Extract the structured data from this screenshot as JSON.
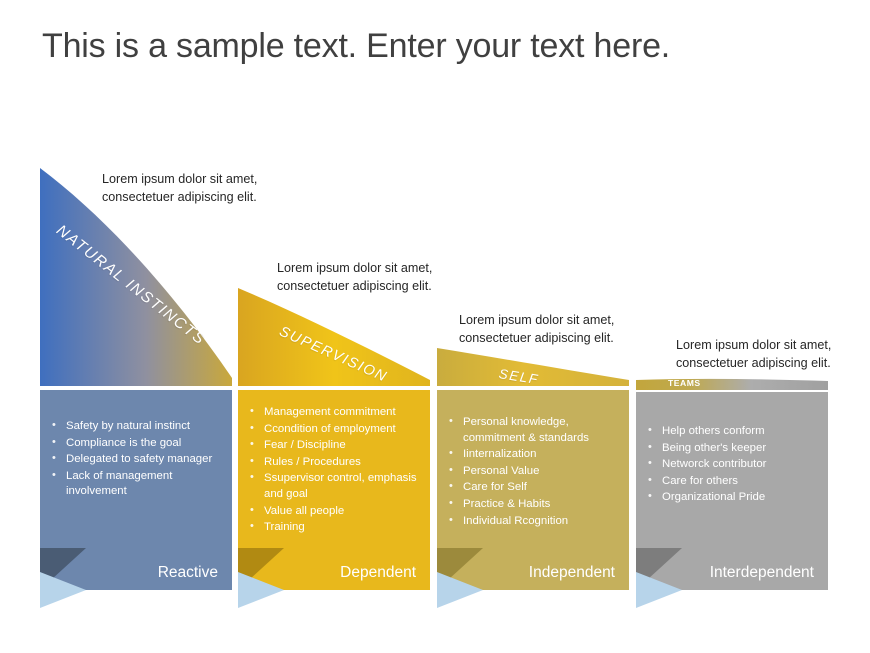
{
  "slide": {
    "title": "This is a sample text. Enter your text here.",
    "background": "#ffffff"
  },
  "stages": [
    {
      "id": "natural-instincts",
      "caption_line1": "Lorem ipsum dolor sit amet,",
      "caption_line2": "consectetuer adipiscing elit.",
      "curve_label": "NATURAL INSTINCTS",
      "footer_label": "Reactive",
      "header_color_start": "#3f6fbf",
      "header_color_end": "#c9a83c",
      "body_color": "#6d87ad",
      "footer_color": "#6d87ad",
      "bullets": [
        "Safety by natural instinct",
        "Compliance is the goal",
        "Delegated to safety manager",
        "Lack of management involvement"
      ]
    },
    {
      "id": "supervision",
      "caption_line1": "Lorem ipsum dolor sit amet,",
      "caption_line2": "consectetuer adipiscing elit.",
      "curve_label": "SUPERVISION",
      "footer_label": "Dependent",
      "header_color_start": "#d9a520",
      "header_color_end": "#f0c419",
      "body_color": "#e8b81c",
      "footer_color": "#e8b81c",
      "bullets": [
        "Management commitment",
        "Ccondition of employment",
        "Fear / Discipline",
        "Rules / Procedures",
        "Ssupervisor control, emphasis and goal",
        "Value all people",
        "Training"
      ]
    },
    {
      "id": "self",
      "caption_line1": "Lorem ipsum dolor sit amet,",
      "caption_line2": "consectetuer adipiscing elit.",
      "curve_label": "SELF",
      "footer_label": "Independent",
      "header_color_start": "#c9ac3e",
      "header_color_end": "#e2bb35",
      "body_color": "#c5b05c",
      "footer_color": "#c5b05c",
      "bullets": [
        "Personal knowledge, commitment & standards",
        "Iinternalization",
        "Personal Value",
        "Care for Self",
        "Practice & Habits",
        "Individual Rcognition"
      ]
    },
    {
      "id": "teams",
      "caption_line1": "Lorem ipsum dolor sit amet,",
      "caption_line2": "consectetuer adipiscing elit.",
      "curve_label": "TEAMS",
      "footer_label": "Interdependent",
      "header_color_start": "#bda martin",
      "header_color_end": "#a8a8a8",
      "body_color": "#a8a8a8",
      "footer_color": "#a8a8a8",
      "strip_color_start": "#c2a champagne",
      "bullets": [
        "Help others conform",
        "Being other's keeper",
        "Networck contributor",
        "Care for others",
        "Organizational Pride"
      ]
    }
  ],
  "colors": {
    "fold_page": "#b7d4ea",
    "fold_shadow_blue": "#4f6party",
    "title_color": "#404040",
    "caption_color": "#262626"
  }
}
